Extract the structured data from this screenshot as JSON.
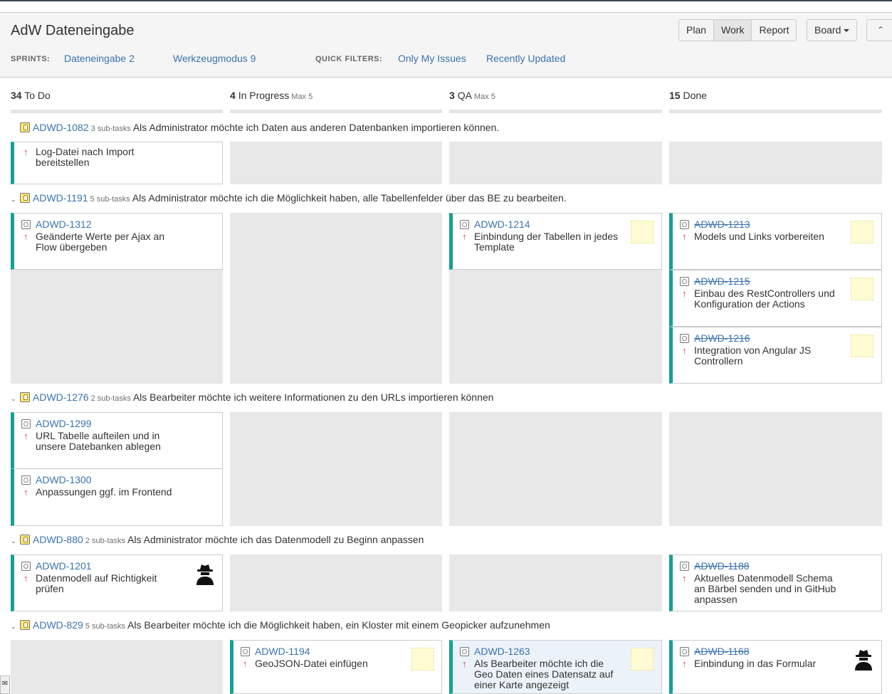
{
  "board": {
    "title": "AdW Dateneingabe",
    "modes": [
      "Plan",
      "Work",
      "Report"
    ],
    "active_mode": "Work",
    "board_menu": "Board",
    "sprints_label": "SPRINTS:",
    "sprints": [
      "Dateneingabe 2",
      "Werkzeugmodus 9"
    ],
    "quick_filters_label": "QUICK FILTERS:",
    "quick_filters": [
      "Only My Issues",
      "Recently Updated"
    ]
  },
  "columns": [
    {
      "count": "34",
      "name": "To Do",
      "max": ""
    },
    {
      "count": "4",
      "name": "In Progress",
      "max": "Max 5"
    },
    {
      "count": "3",
      "name": "QA",
      "max": "Max 5"
    },
    {
      "count": "15",
      "name": "Done",
      "max": ""
    }
  ],
  "swimlanes": [
    {
      "key": "ADWD-1082",
      "subtasks": "3 sub-tasks",
      "summary": "Als Administrator möchte ich Daten aus anderen Datenbanken importieren können."
    },
    {
      "key": "ADWD-1191",
      "subtasks": "5 sub-tasks",
      "summary": "Als Administrator möchte ich die Möglichkeit haben, alle Tabellenfelder über das BE zu bearbeiten."
    },
    {
      "key": "ADWD-1276",
      "subtasks": "2 sub-tasks",
      "summary": "Als Bearbeiter möchte ich weitere Informationen zu den URLs importieren können"
    },
    {
      "key": "ADWD-880",
      "subtasks": "2 sub-tasks",
      "summary": "Als Administrator möchte ich das Datenmodell zu Beginn anpassen"
    },
    {
      "key": "ADWD-829",
      "subtasks": "5 sub-tasks",
      "summary": "Als Bearbeiter möchte ich die Möglichkeit haben, ein Kloster mit einem Geopicker aufzunehmen"
    }
  ],
  "cards": {
    "c1207": {
      "key": "",
      "summary_1": "Log-Datei nach Import",
      "summary_2": "bereitstellen",
      "summary_3": ""
    },
    "c1312": {
      "key": "ADWD-1312",
      "summary_1": "Geänderte Werte per Ajax an",
      "summary_2": "Flow übergeben",
      "summary_3": ""
    },
    "c1214": {
      "key": "ADWD-1214",
      "summary_1": "Einbindung der Tabellen in jedes",
      "summary_2": "Template",
      "summary_3": ""
    },
    "c1213": {
      "key": "ADWD-1213",
      "summary_1": "Models und Links vorbereiten",
      "summary_2": "",
      "summary_3": ""
    },
    "c1215": {
      "key": "ADWD-1215",
      "summary_1": "Einbau des RestControllers und",
      "summary_2": "Konfiguration der Actions",
      "summary_3": ""
    },
    "c1216": {
      "key": "ADWD-1216",
      "summary_1": "Integration von Angular JS",
      "summary_2": "Controllern",
      "summary_3": ""
    },
    "c1299": {
      "key": "ADWD-1299",
      "summary_1": "URL Tabelle aufteilen und in",
      "summary_2": "unsere Datebanken ablegen",
      "summary_3": ""
    },
    "c1300": {
      "key": "ADWD-1300",
      "summary_1": "Anpassungen ggf. im Frontend",
      "summary_2": "",
      "summary_3": ""
    },
    "c1201": {
      "key": "ADWD-1201",
      "summary_1": "Datenmodell auf Richtigkeit",
      "summary_2": "prüfen",
      "summary_3": ""
    },
    "c1188": {
      "key": "ADWD-1188",
      "summary_1": "Aktuelles Datenmodell Schema",
      "summary_2": "an Bärbel senden und in GitHub",
      "summary_3": "anpassen"
    },
    "c1194": {
      "key": "ADWD-1194",
      "summary_1": "GeoJSON-Datei einfügen",
      "summary_2": "",
      "summary_3": ""
    },
    "c1263": {
      "key": "ADWD-1263",
      "summary_1": "Als Bearbeiter möchte ich die",
      "summary_2": "Geo Daten eines Datensatz auf",
      "summary_3": "einer Karte angezeigt"
    },
    "c1168": {
      "key": "ADWD-1168",
      "summary_1": "Einbindung in das Formular",
      "summary_2": "",
      "summary_3": ""
    }
  },
  "colors": {
    "accent": "#3b73af",
    "card_bar": "#14a097",
    "priority": "#d04437"
  }
}
